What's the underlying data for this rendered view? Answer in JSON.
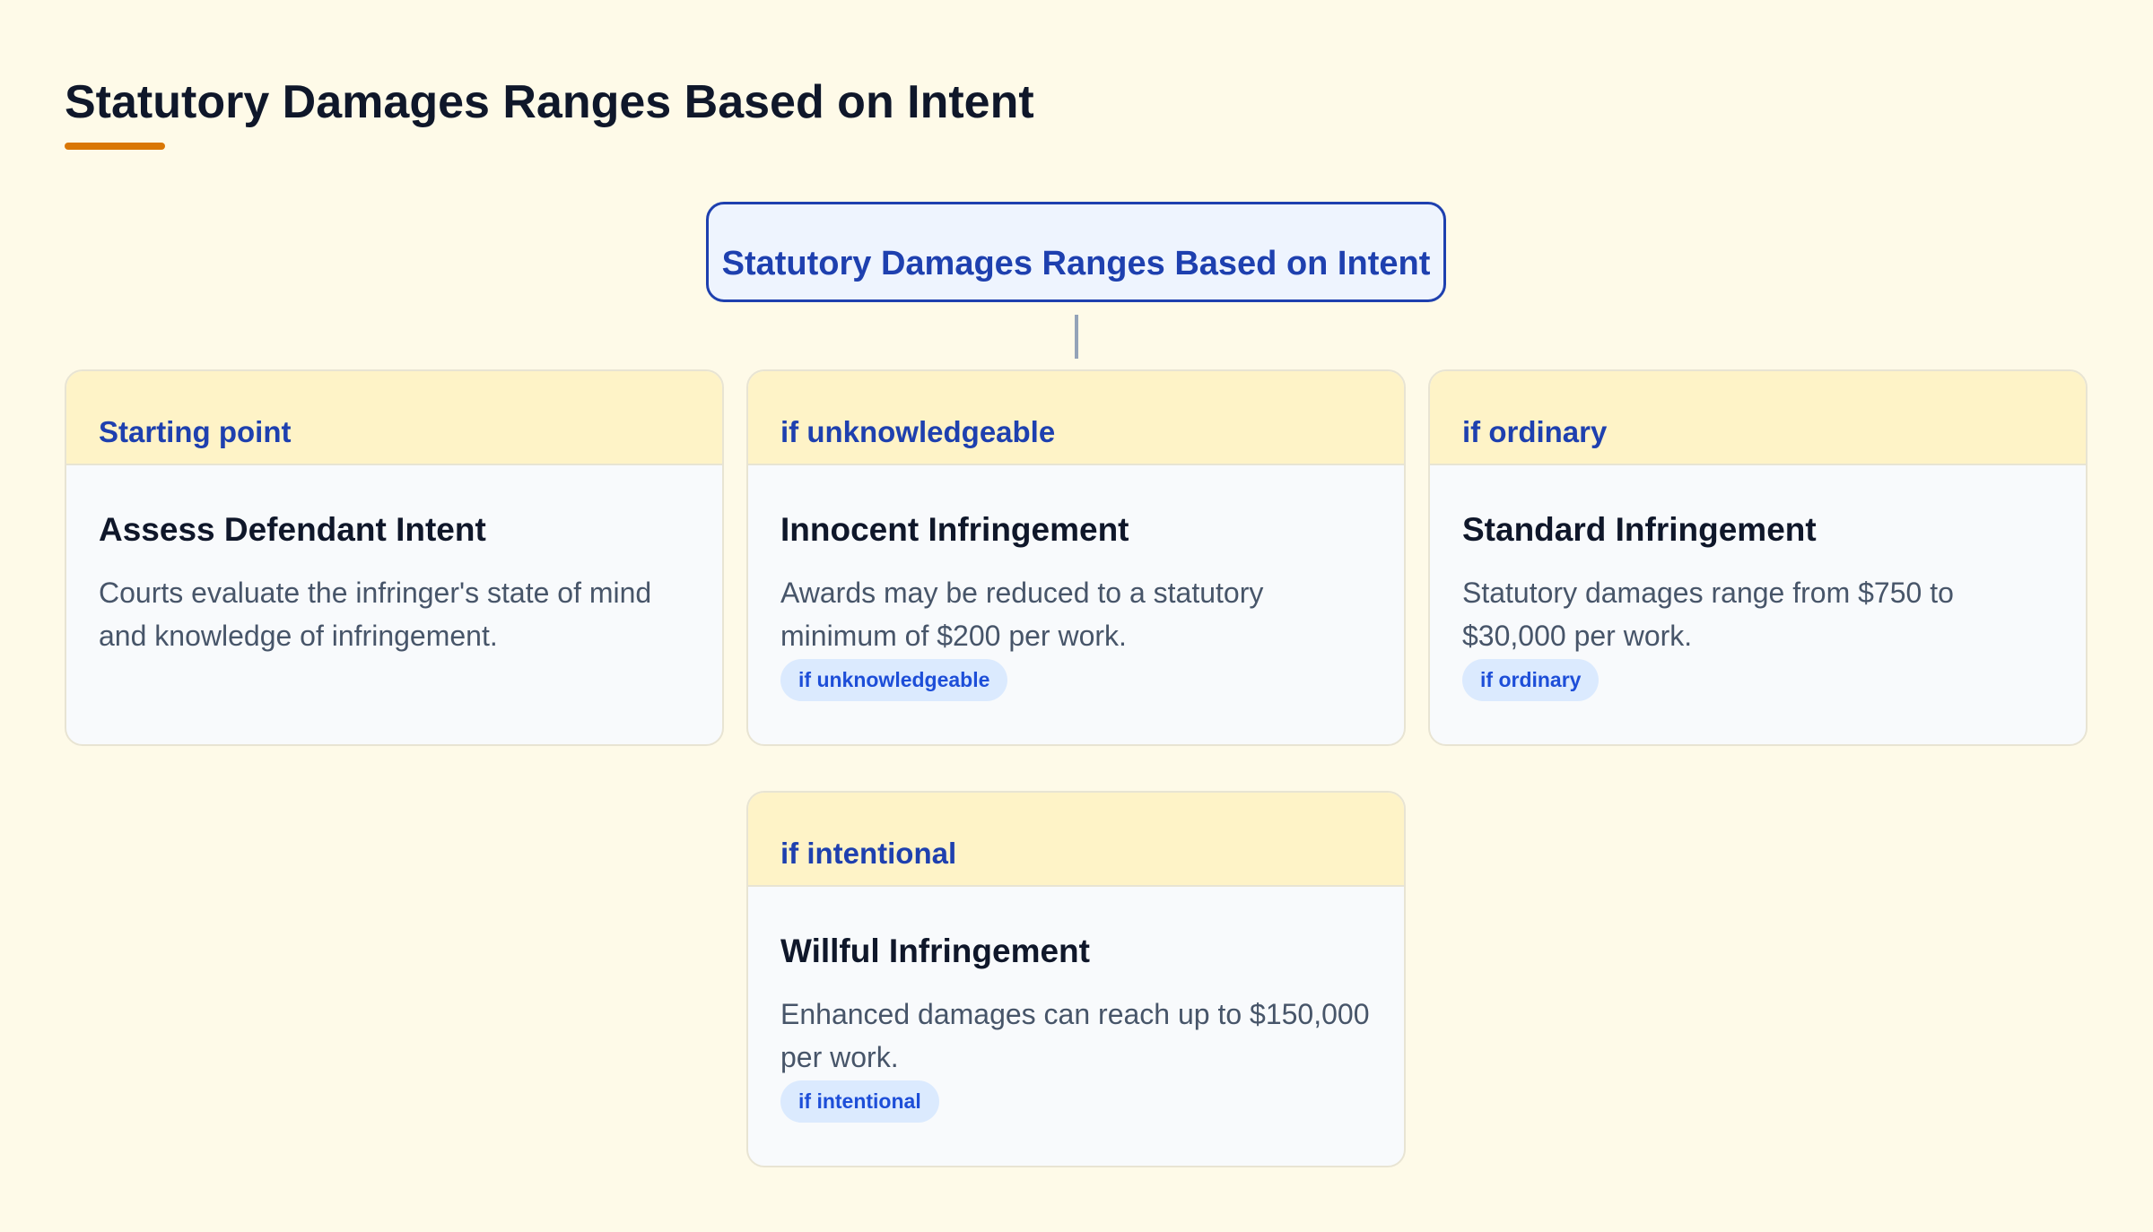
{
  "page": {
    "title": "Statutory Damages Ranges Based on Intent"
  },
  "diagram": {
    "root": {
      "label": "Statutory Damages Ranges Based on Intent"
    },
    "nodes": [
      {
        "condition": "Starting point",
        "heading": "Assess Defendant Intent",
        "description": "Courts evaluate the infringer's state of mind and knowledge of infringement.",
        "badge": ""
      },
      {
        "condition": "if unknowledgeable",
        "heading": "Innocent Infringement",
        "description": "Awards may be reduced to a statutory minimum of $200 per work.",
        "badge": "if unknowledgeable"
      },
      {
        "condition": "if ordinary",
        "heading": "Standard Infringement",
        "description": "Statutory damages range from $750 to $30,000 per work.",
        "badge": "if ordinary"
      },
      {
        "condition": "if intentional",
        "heading": "Willful Infringement",
        "description": "Enhanced damages can reach up to $150,000 per work.",
        "badge": "if intentional"
      }
    ]
  },
  "colors": {
    "background": "#fefae8",
    "accent": "#d97706",
    "primary": "#1e40af",
    "card_header": "#fef3c7",
    "badge_bg": "#dbeafe"
  }
}
